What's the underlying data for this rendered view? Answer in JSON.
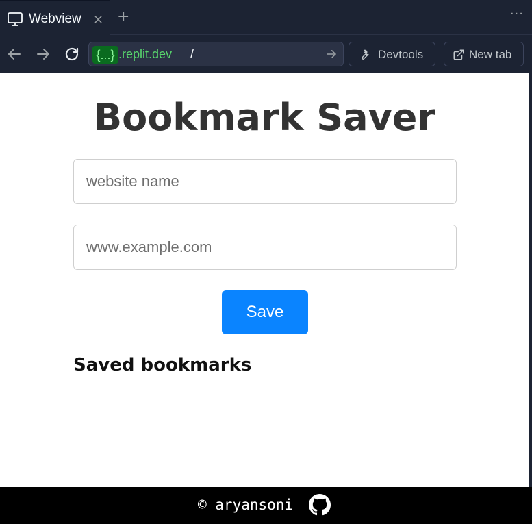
{
  "browser": {
    "tab": {
      "title": "Webview",
      "close": "×"
    },
    "new_tab": "+",
    "more": "···",
    "url": {
      "badge": "{...}",
      "domain": ".replit.dev",
      "path": "/"
    },
    "devtools_label": "Devtools",
    "open_new_tab_label": "New tab"
  },
  "page": {
    "title": "Bookmark Saver",
    "name_placeholder": "website name",
    "url_placeholder": "www.example.com",
    "save_label": "Save",
    "saved_heading": "Saved bookmarks",
    "footer_text": "© aryansoni"
  },
  "colors": {
    "chrome_bg": "#1c2333",
    "accent_button": "#0a84ff",
    "url_badge": "#0a6b1f",
    "url_domain": "#58d66d"
  },
  "icons": [
    "monitor-icon",
    "close-icon",
    "plus-icon",
    "more-icon",
    "back-arrow-icon",
    "forward-arrow-icon",
    "reload-icon",
    "go-arrow-icon",
    "wrench-icon",
    "external-link-icon",
    "github-icon"
  ]
}
